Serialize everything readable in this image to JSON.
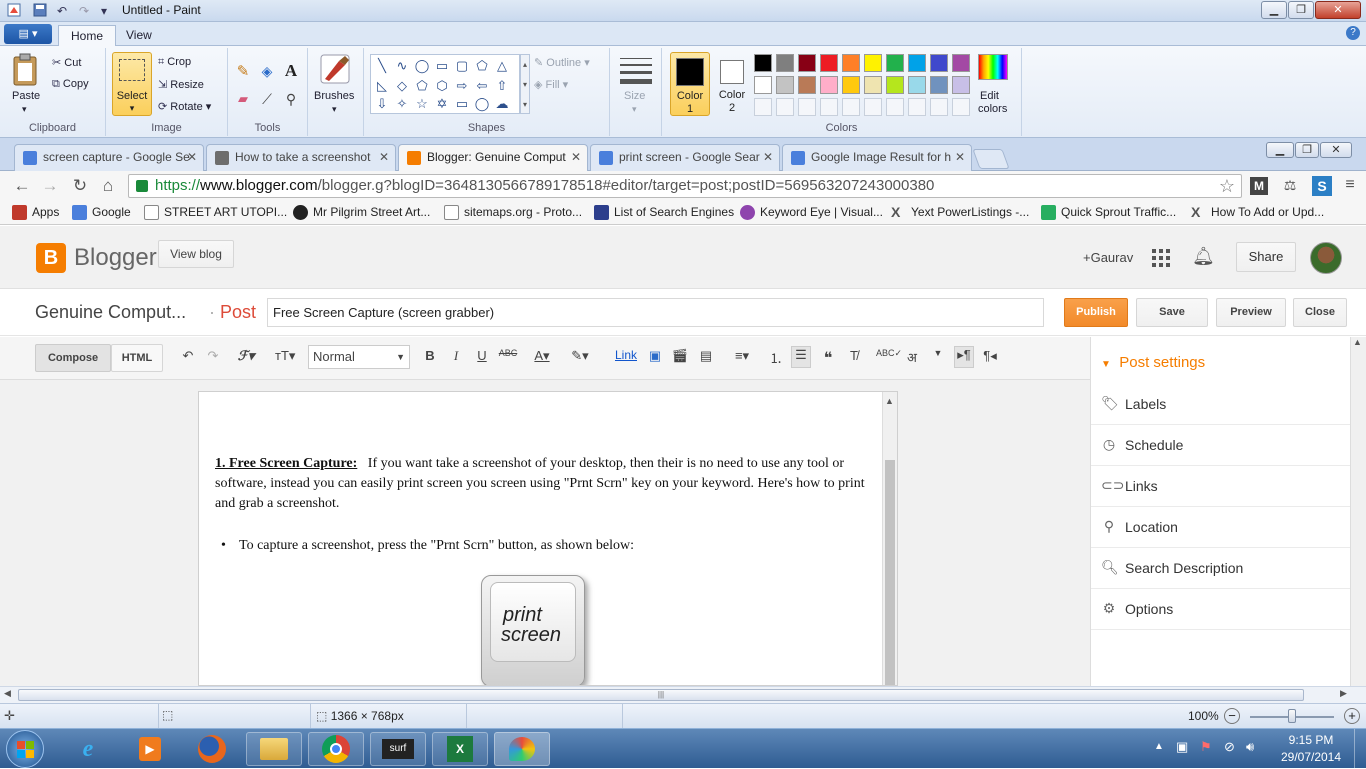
{
  "paint": {
    "window_title": "Untitled - Paint",
    "tabs": [
      "Home",
      "View"
    ],
    "clipboard": {
      "paste": "Paste",
      "cut": "Cut",
      "copy": "Copy",
      "group": "Clipboard"
    },
    "image": {
      "select": "Select",
      "crop": "Crop",
      "resize": "Resize",
      "rotate": "Rotate",
      "group": "Image"
    },
    "tools": {
      "group": "Tools"
    },
    "brushes": "Brushes",
    "shapes": {
      "outline": "Outline",
      "fill": "Fill",
      "group": "Shapes"
    },
    "size": "Size",
    "color1": {
      "line1": "Color",
      "line2": "1"
    },
    "color2": {
      "line1": "Color",
      "line2": "2"
    },
    "colors_group": "Colors",
    "edit_colors": {
      "line1": "Edit",
      "line2": "colors"
    },
    "palette_row1": [
      "#000000",
      "#7f7f7f",
      "#880015",
      "#ed1c24",
      "#ff7f27",
      "#fff200",
      "#22b14c",
      "#00a2e8",
      "#3f48cc",
      "#a349a4"
    ],
    "palette_row2": [
      "#ffffff",
      "#c3c3c3",
      "#b97a57",
      "#ffaec9",
      "#ffc90e",
      "#efe4b0",
      "#b5e61d",
      "#99d9ea",
      "#7092be",
      "#c8bfe7"
    ],
    "status": {
      "dimensions": "1366 × 768px",
      "zoom": "100%"
    }
  },
  "browser": {
    "tabs": [
      {
        "title": "screen capture - Google Se",
        "color": "#4a7fdc"
      },
      {
        "title": "How to take a screenshot",
        "color": "#6d6d6d"
      },
      {
        "title": "Blogger: Genuine Comput",
        "color": "#f57d00"
      },
      {
        "title": "print screen - Google Sear",
        "color": "#4a7fdc"
      },
      {
        "title": "Google Image Result for h",
        "color": "#4a7fdc"
      }
    ],
    "url_scheme": "https://",
    "url_host": "www.blogger.com",
    "url_path": "/blogger.g?blogID=3648130566789178518#editor/target=post;postID=569563207243000380",
    "bookmarks": [
      {
        "label": "Apps",
        "color": "#c0392b"
      },
      {
        "label": "Google",
        "color": "#4a7fdc"
      },
      {
        "label": "STREET ART UTOPI...",
        "color": "#ffffff"
      },
      {
        "label": "Mr Pilgrim Street Art...",
        "color": "#222222"
      },
      {
        "label": "sitemaps.org - Proto...",
        "color": "#ffffff"
      },
      {
        "label": "List of Search Engines",
        "color": "#2c3e8c"
      },
      {
        "label": "Keyword Eye | Visual...",
        "color": "#8e44ad"
      },
      {
        "label": "Yext PowerListings -...",
        "color": "#555555"
      },
      {
        "label": "Quick Sprout Traffic...",
        "color": "#27ae60"
      },
      {
        "label": "How To Add or Upd...",
        "color": "#555555"
      }
    ]
  },
  "blogger": {
    "logo": "Blogger",
    "view_blog": "View blog",
    "user": "+Gaurav",
    "share": "Share",
    "blog_name": "Genuine Comput...",
    "sep": "·",
    "post_label": "Post",
    "post_title": "Free Screen Capture (screen grabber)",
    "publish": "Publish",
    "save": "Save",
    "preview": "Preview",
    "close": "Close",
    "compose": "Compose",
    "html": "HTML",
    "format": "Normal",
    "link": "Link",
    "hindi": "अ",
    "post_settings": "Post settings",
    "settings": [
      "Labels",
      "Schedule",
      "Links",
      "Location",
      "Search Description",
      "Options"
    ]
  },
  "post": {
    "heading": "1. Free Screen Capture:",
    "para": "If you want take a screenshot of your desktop, then their is no need to use any tool or software, instead you can easily print screen you screen using \"Prnt Scrn\" key on your keyword. Here's how to print and grab a screenshot.",
    "bullet": "To capture a screenshot, press the \"Prnt Scrn\" button, as shown below:",
    "key_line1": "print",
    "key_line2": "screen"
  },
  "taskbar": {
    "time": "9:15 PM",
    "date": "29/07/2014"
  }
}
